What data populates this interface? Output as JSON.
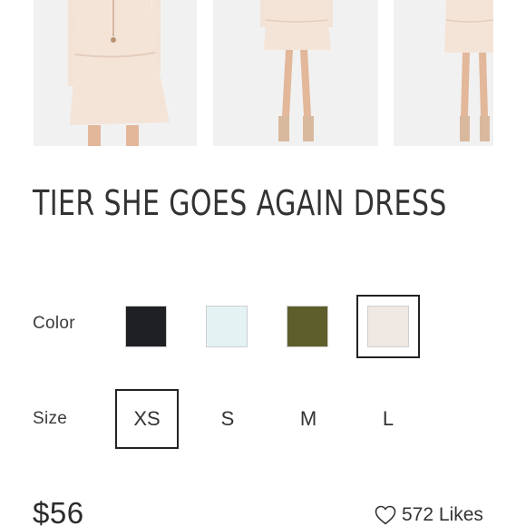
{
  "product": {
    "title": "TIER SHE GOES AGAIN DRESS",
    "price": "$56",
    "likes_text": "572 Likes",
    "like_icon": "heart-outline-icon"
  },
  "gallery": {
    "images": [
      {
        "name": "dress-front-closeup"
      },
      {
        "name": "dress-full-front"
      },
      {
        "name": "dress-full-side"
      }
    ]
  },
  "color_option": {
    "label": "Color",
    "swatches": [
      {
        "color": "#1f2024"
      },
      {
        "color": "#e4f2f4"
      },
      {
        "color": "#5d5e2c"
      },
      {
        "color": "#f0e8e2",
        "selected": true
      }
    ]
  },
  "size_option": {
    "label": "Size",
    "sizes": [
      "XS",
      "S",
      "M",
      "L"
    ],
    "selected": "XS"
  }
}
